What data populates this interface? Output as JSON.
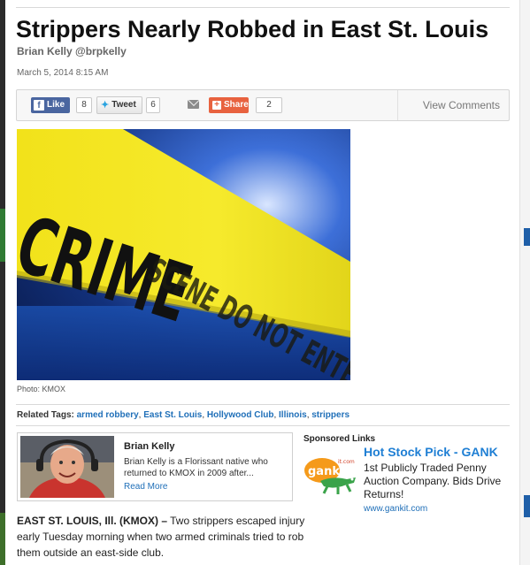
{
  "article": {
    "title": "Strippers Nearly Robbed in East St. Louis",
    "byline": "Brian Kelly @brpkelly",
    "date": "March 5, 2014 8:15 AM",
    "photo_caption": "Photo: KMOX",
    "photo_text": {
      "word1": "CRIME",
      "word2": "SCENE DO NOT ENTER"
    }
  },
  "share": {
    "like_label": "Like",
    "like_count": "8",
    "tweet_label": "Tweet",
    "tweet_count": "6",
    "share_label": "Share",
    "share_count": "2",
    "view_comments": "View Comments",
    "icons": {
      "facebook": "facebook-icon",
      "twitter": "twitter-icon",
      "mail": "mail-icon",
      "share": "plus-icon"
    }
  },
  "related": {
    "label": "Related Tags:",
    "tags": [
      "armed robbery",
      "East St. Louis",
      "Hollywood Club",
      "Illinois",
      "strippers"
    ],
    "sep": ","
  },
  "author": {
    "name": "Brian Kelly",
    "bio": "Brian Kelly is a Florissant native who returned to KMOX in 2009 after...",
    "more": "Read More"
  },
  "sponsored": {
    "label": "Sponsored Links",
    "logo_text": "gank",
    "logo_suffix": "it.com",
    "title": "Hot Stock Pick - GANK",
    "text": "1st Publicly Traded Penny Auction Company. Bids Drive Returns!",
    "url": "www.gankit.com"
  },
  "body": {
    "dateline": "EAST ST. LOUIS, Ill. (KMOX) –",
    "text": " Two strippers escaped injury early Tuesday morning when two armed criminals tried to rob them outside an east-side club."
  },
  "colors": {
    "link": "#1f6fb8",
    "facebook": "#4a66a0",
    "share": "#e8623f",
    "ad_title": "#1f7fd4"
  }
}
